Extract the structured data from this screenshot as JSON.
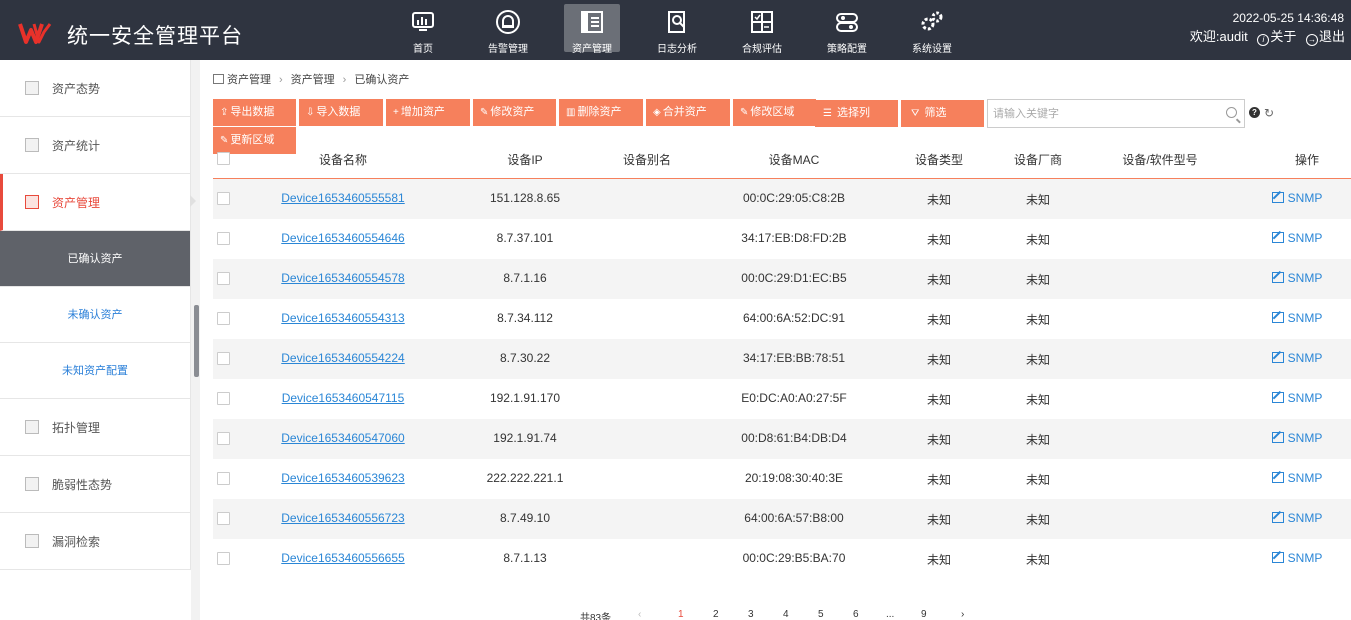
{
  "header": {
    "app_title": "统一安全管理平台",
    "datetime": "2022-05-25 14:36:48",
    "welcome": "欢迎:audit",
    "about": "关于",
    "logout": "退出",
    "nav": [
      {
        "label": "首页",
        "icon": "monitor-chart-icon"
      },
      {
        "label": "告警管理",
        "icon": "alarm-bell-icon"
      },
      {
        "label": "资产管理",
        "icon": "asset-server-icon"
      },
      {
        "label": "日志分析",
        "icon": "log-search-icon"
      },
      {
        "label": "合规评估",
        "icon": "compliance-grid-icon"
      },
      {
        "label": "策略配置",
        "icon": "policy-config-icon"
      },
      {
        "label": "系统设置",
        "icon": "gears-icon"
      }
    ],
    "active_nav": "资产管理"
  },
  "sidebar": {
    "items": [
      {
        "label": "资产态势"
      },
      {
        "label": "资产统计"
      },
      {
        "label": "资产管理"
      },
      {
        "label": "拓扑管理"
      },
      {
        "label": "脆弱性态势"
      },
      {
        "label": "漏洞检索"
      }
    ],
    "sub_items": [
      {
        "label": "已确认资产"
      },
      {
        "label": "未确认资产"
      },
      {
        "label": "未知资产配置"
      }
    ]
  },
  "breadcrumb": [
    "资产管理",
    "资产管理",
    "已确认资产"
  ],
  "toolbar": {
    "buttons": [
      {
        "label": "导出数据",
        "icon": "export-icon"
      },
      {
        "label": "导入数据",
        "icon": "import-icon"
      },
      {
        "label": "增加资产",
        "icon": "plus-icon"
      },
      {
        "label": "修改资产",
        "icon": "edit-icon"
      },
      {
        "label": "删除资产",
        "icon": "trash-icon"
      },
      {
        "label": "合并资产",
        "icon": "merge-icon"
      },
      {
        "label": "修改区域",
        "icon": "edit-icon"
      },
      {
        "label": "选择列",
        "icon": "list-icon"
      },
      {
        "label": "筛选",
        "icon": "filter-icon"
      },
      {
        "label": "更新区域",
        "icon": "edit-icon"
      }
    ],
    "search_placeholder": "请输入关键字"
  },
  "table": {
    "columns": [
      "设备名称",
      "设备IP",
      "设备别名",
      "设备MAC",
      "设备类型",
      "设备厂商",
      "设备/软件型号",
      "操作"
    ],
    "rows": [
      {
        "name": "Device1653460555581",
        "ip": "151.128.8.65",
        "alias": "",
        "mac": "00:0C:29:05:C8:2B",
        "type": "未知",
        "vendor": "未知",
        "model": "",
        "action": "SNMP"
      },
      {
        "name": "Device1653460554646",
        "ip": "8.7.37.101",
        "alias": "",
        "mac": "34:17:EB:D8:FD:2B",
        "type": "未知",
        "vendor": "未知",
        "model": "",
        "action": "SNMP"
      },
      {
        "name": "Device1653460554578",
        "ip": "8.7.1.16",
        "alias": "",
        "mac": "00:0C:29:D1:EC:B5",
        "type": "未知",
        "vendor": "未知",
        "model": "",
        "action": "SNMP"
      },
      {
        "name": "Device1653460554313",
        "ip": "8.7.34.112",
        "alias": "",
        "mac": "64:00:6A:52:DC:91",
        "type": "未知",
        "vendor": "未知",
        "model": "",
        "action": "SNMP"
      },
      {
        "name": "Device1653460554224",
        "ip": "8.7.30.22",
        "alias": "",
        "mac": "34:17:EB:BB:78:51",
        "type": "未知",
        "vendor": "未知",
        "model": "",
        "action": "SNMP"
      },
      {
        "name": "Device1653460547115",
        "ip": "192.1.91.170",
        "alias": "",
        "mac": "E0:DC:A0:A0:27:5F",
        "type": "未知",
        "vendor": "未知",
        "model": "",
        "action": "SNMP"
      },
      {
        "name": "Device1653460547060",
        "ip": "192.1.91.74",
        "alias": "",
        "mac": "00:D8:61:B4:DB:D4",
        "type": "未知",
        "vendor": "未知",
        "model": "",
        "action": "SNMP"
      },
      {
        "name": "Device1653460539623",
        "ip": "222.222.221.1",
        "alias": "",
        "mac": "20:19:08:30:40:3E",
        "type": "未知",
        "vendor": "未知",
        "model": "",
        "action": "SNMP"
      },
      {
        "name": "Device1653460556723",
        "ip": "8.7.49.10",
        "alias": "",
        "mac": "64:00:6A:57:B8:00",
        "type": "未知",
        "vendor": "未知",
        "model": "",
        "action": "SNMP"
      },
      {
        "name": "Device1653460556655",
        "ip": "8.7.1.13",
        "alias": "",
        "mac": "00:0C:29:B5:BA:70",
        "type": "未知",
        "vendor": "未知",
        "model": "",
        "action": "SNMP"
      }
    ]
  },
  "pagination": {
    "total": "共83条",
    "prev": "‹",
    "pages": [
      "1",
      "2",
      "3",
      "4",
      "5",
      "6",
      "...",
      "9"
    ],
    "next": "›",
    "current": "1"
  },
  "colors": {
    "header_bg": "#2f3440",
    "accent": "#f6805c",
    "active_red": "#e84a3c",
    "link": "#2a86d6"
  }
}
